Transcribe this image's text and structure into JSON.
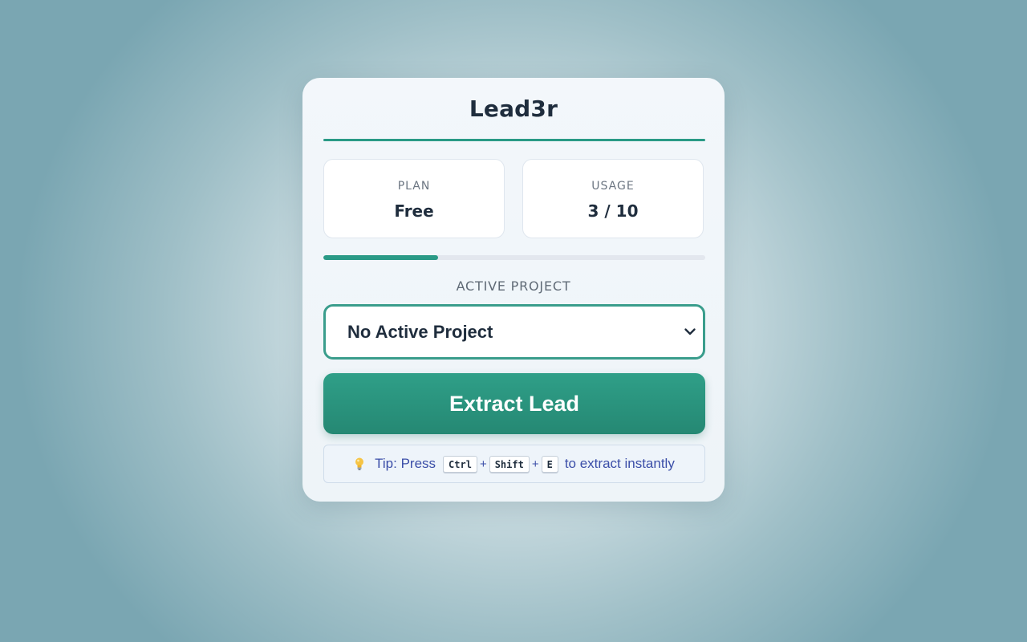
{
  "app": {
    "title": "Lead3r"
  },
  "stats": {
    "plan_label": "PLAN",
    "plan_value": "Free",
    "usage_label": "USAGE",
    "usage_value": "3 / 10",
    "usage_progress_fraction": 0.3
  },
  "project": {
    "section_label": "ACTIVE PROJECT",
    "selected": "No Active Project"
  },
  "actions": {
    "extract_label": "Extract Lead"
  },
  "tip": {
    "icon": "lightbulb-icon",
    "prefix": "Tip: Press",
    "keys": [
      "Ctrl",
      "Shift",
      "E"
    ],
    "separator": "+",
    "suffix": "to extract instantly"
  },
  "colors": {
    "accent": "#2a9a86",
    "title": "#1f2d3d",
    "tip_text": "#3b4ea8"
  }
}
